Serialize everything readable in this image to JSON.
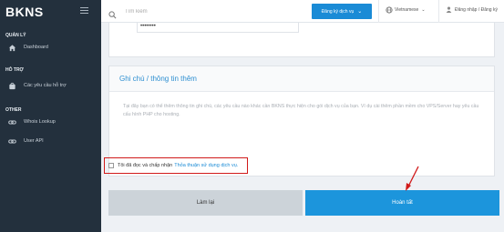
{
  "brand": {
    "logo_text": "BKNS"
  },
  "sidebar": {
    "sections": [
      {
        "title": "QUẢN LÝ",
        "items": [
          {
            "label": "Dashboard",
            "icon": "home-icon"
          }
        ]
      },
      {
        "title": "HỖ TRỢ",
        "items": [
          {
            "label": "Các yêu cầu hỗ trợ",
            "icon": "support-icon"
          }
        ]
      },
      {
        "title": "OTHER",
        "items": [
          {
            "label": "Whois Lookup",
            "icon": "link-icon"
          },
          {
            "label": "User API",
            "icon": "link-icon"
          }
        ]
      }
    ]
  },
  "topbar": {
    "search_placeholder": "Tìm kiếm",
    "register_label": "Đăng ký dịch vụ",
    "language_label": "Vietnamese",
    "login_label": "Đăng nhập / Đăng ký"
  },
  "form": {
    "password_mask": "••••••••",
    "note_title": "Ghi chú / thông tin thêm",
    "note_placeholder": "Tại đây bạn có thể thêm thông tin ghi chú, các yêu cầu nào khác cần BKNS thực hiện cho gói dịch vụ của bạn. Ví dụ cài thêm phần mềm cho VPS/Server hay yêu cầu cấu hình PHP cho hosting.",
    "agree_text": "Tôi đã đọc và chấp nhận",
    "agree_link": "Thỏa thuận sử dụng dịch vụ.",
    "agree_checked": false,
    "reset_label": "Làm lại",
    "submit_label": "Hoàn tất"
  },
  "colors": {
    "primary": "#1c95dc",
    "sidebar": "#23303d",
    "highlight": "#d11a1a"
  }
}
